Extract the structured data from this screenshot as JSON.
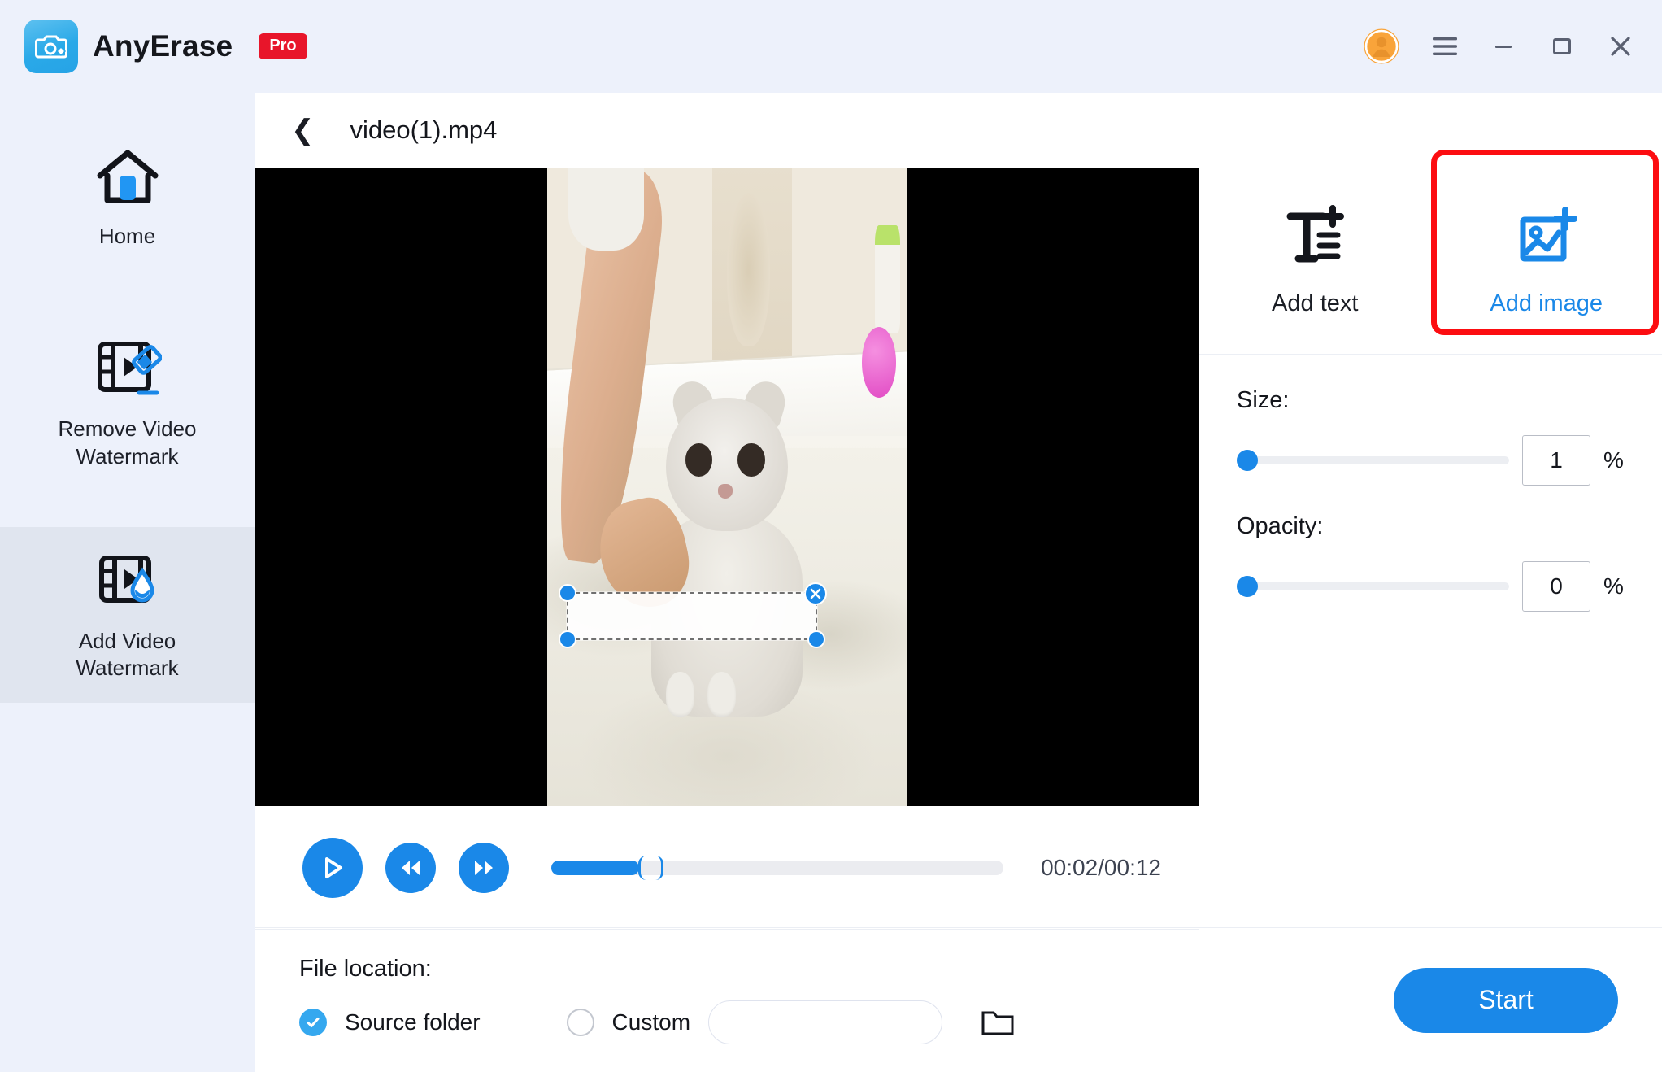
{
  "titlebar": {
    "brand": "AnyErase",
    "badge": "Pro",
    "logo_icon": "camera-logo-icon",
    "account_icon": "user-avatar-icon",
    "menu_icon": "hamburger-menu-icon",
    "minimize_icon": "minimize-icon",
    "maximize_icon": "maximize-icon",
    "close_icon": "close-icon",
    "logo_color": "#2aa9e8",
    "badge_color": "#e8152a"
  },
  "sidebar": {
    "items": [
      {
        "label": "Home",
        "icon": "home-icon",
        "selected": false
      },
      {
        "label": "Remove Video\nWatermark",
        "line1": "Remove Video",
        "line2": "Watermark",
        "icon": "remove-video-watermark-icon",
        "selected": false
      },
      {
        "label": "Add Video\nWatermark",
        "line1": "Add Video",
        "line2": "Watermark",
        "icon": "add-video-watermark-icon",
        "selected": true
      }
    ],
    "background": "#edf1fb",
    "selected_background": "#e0e5ef"
  },
  "main": {
    "back_icon": "back-chevron-icon",
    "file_name": "video(1).mp4"
  },
  "player": {
    "play_icon": "play-icon",
    "rewind_icon": "rewind-icon",
    "forward_icon": "fast-forward-icon",
    "progress_percent": 19.5,
    "time_display": "00:02/00:12",
    "current_time": "00:02",
    "total_time": "00:12",
    "accent_color": "#1a88e8"
  },
  "watermark_overlay": {
    "close_icon": "close-watermark-icon",
    "handle_icon": "resize-handle-icon",
    "handle_color": "#1a88e8"
  },
  "tools": {
    "tabs": [
      {
        "label": "Add text",
        "icon": "add-text-icon",
        "active": false
      },
      {
        "label": "Add image",
        "icon": "add-image-icon",
        "active": true
      }
    ],
    "annotation_color": "#fc0d11",
    "active_color": "#1a88e8",
    "size": {
      "label": "Size:",
      "value": "1",
      "unit": "%",
      "slider_percent": 0
    },
    "opacity": {
      "label": "Opacity:",
      "value": "0",
      "unit": "%",
      "slider_percent": 0
    }
  },
  "footer": {
    "file_location_label": "File location:",
    "source_folder_label": "Source folder",
    "source_folder_selected": true,
    "custom_label": "Custom",
    "custom_selected": false,
    "custom_path_value": "",
    "custom_path_placeholder": "",
    "browse_icon": "folder-icon",
    "start_label": "Start",
    "start_color": "#1a88e8"
  }
}
